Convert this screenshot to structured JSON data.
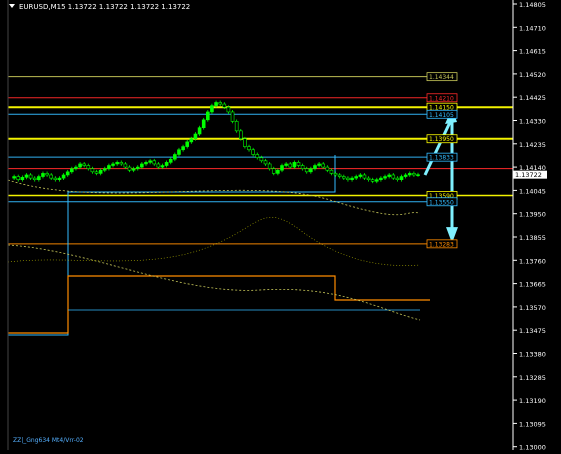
{
  "header": {
    "symbol_text": "EURUSD,M15  1.13722 1.13722 1.13722 1.13722"
  },
  "footer": {
    "indicator_text": "ZZ|_Gng634 Mt4/Vrr-02"
  },
  "colors": {
    "background": "#000000",
    "axis": "#ffffff",
    "bull": "#00ff00",
    "bear": "#00ff00",
    "yellow": "#ffff00",
    "blue": "#33bbff",
    "red": "#ff2a2a",
    "orange": "#ff8c00",
    "olive": "#c8c85a",
    "cyan_arrow": "#7ff0ff",
    "current_price_bg": "#ffffff",
    "current_price_text": "#000000"
  },
  "chart_data": {
    "type": "candlestick",
    "title": "",
    "ylim": [
      1.12,
      1.14805
    ],
    "price_axis_ticks": [
      "1.14805",
      "1.14710",
      "1.14615",
      "1.14520",
      "1.14425",
      "1.14330",
      "1.14235",
      "1.14140",
      "1.14045",
      "1.13950",
      "1.13855",
      "1.13760",
      "1.13665",
      "1.13570",
      "1.13475",
      "1.13380",
      "1.13285",
      "1.13190",
      "1.13095",
      "1.13000"
    ],
    "level_labels": [
      {
        "text": "1.14344",
        "price": 1.14344,
        "color": "#c8c85a"
      },
      {
        "text": "1.14210",
        "price": 1.1421,
        "color": "#ff2a2a"
      },
      {
        "text": "1.14150",
        "price": 1.1415,
        "color": "#ffff00"
      },
      {
        "text": "1.14105",
        "price": 1.14105,
        "color": "#33bbff"
      },
      {
        "text": "1.13950",
        "price": 1.1395,
        "color": "#ffff00"
      },
      {
        "text": "1.13833",
        "price": 1.13833,
        "color": "#33bbff"
      },
      {
        "text": "1.13590",
        "price": 1.1359,
        "color": "#ffff00"
      },
      {
        "text": "1.13550",
        "price": 1.1355,
        "color": "#33bbff"
      },
      {
        "text": "1.13283",
        "price": 1.13283,
        "color": "#ff8c00"
      }
    ],
    "current_price": {
      "text": "1.13722",
      "price": 1.13722
    },
    "prices": [
      1.137,
      1.1371,
      1.1369,
      1.13705,
      1.1372,
      1.137,
      1.1369,
      1.1371,
      1.1373,
      1.1372,
      1.137,
      1.1369,
      1.137,
      1.1372,
      1.1374,
      1.1376,
      1.1377,
      1.1379,
      1.1378,
      1.1376,
      1.1374,
      1.1373,
      1.1375,
      1.1376,
      1.1378,
      1.1379,
      1.138,
      1.1379,
      1.1377,
      1.1375,
      1.1376,
      1.1377,
      1.1379,
      1.138,
      1.1381,
      1.1379,
      1.1377,
      1.1378,
      1.138,
      1.1382,
      1.1385,
      1.1388,
      1.139,
      1.1393,
      1.1395,
      1.1398,
      1.1402,
      1.1407,
      1.1412,
      1.1416,
      1.1418,
      1.1417,
      1.1415,
      1.1412,
      1.1406,
      1.14,
      1.1395,
      1.139,
      1.1388,
      1.1385,
      1.1383,
      1.1381,
      1.1379,
      1.1376,
      1.1373,
      1.1375,
      1.1378,
      1.1379,
      1.1377,
      1.138,
      1.1378,
      1.1376,
      1.1374,
      1.1376,
      1.1378,
      1.1379,
      1.1377,
      1.1375,
      1.1373,
      1.1372,
      1.1371,
      1.137,
      1.1369,
      1.137,
      1.1371,
      1.1372,
      1.137,
      1.1369,
      1.1368,
      1.1369,
      1.137,
      1.1371,
      1.1372,
      1.137,
      1.1369,
      1.1371,
      1.1372,
      1.1373,
      1.1372,
      1.13722
    ],
    "projection_up": {
      "from": 1.1372,
      "to": 1.1412
    },
    "projection_down": {
      "from": 1.1412,
      "to": 1.133
    }
  }
}
